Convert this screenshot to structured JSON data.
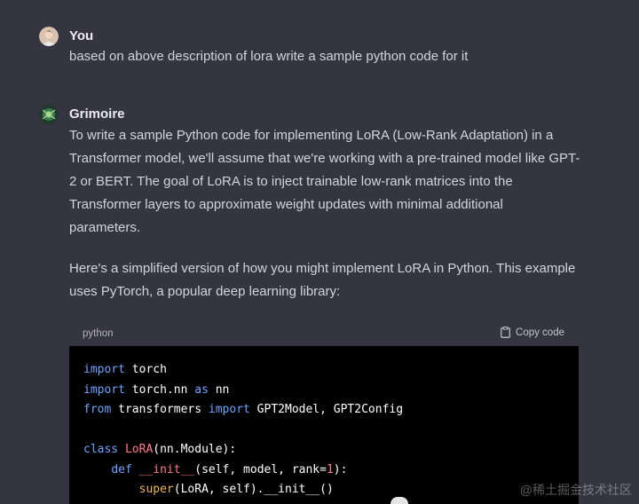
{
  "user_message": {
    "author": "You",
    "text": "based on above description of lora write a sample python code for it"
  },
  "assistant_message": {
    "author": "Grimoire",
    "paragraph1_lines": [
      "To write a sample Python code for implementing LoRA (Low-Rank Adaptation) in a",
      "Transformer model, we'll assume that we're working with a pre-trained model like GPT-",
      "2 or BERT. The goal of LoRA is to inject trainable low-rank matrices into the",
      "Transformer layers to approximate weight updates with minimal additional",
      "parameters."
    ],
    "paragraph2_lines": [
      "Here's a simplified version of how you might implement LoRA in Python. This example",
      "uses PyTorch, a popular deep learning library:"
    ]
  },
  "code_block": {
    "language": "python",
    "copy_label": "Copy code",
    "tokens": {
      "import": "import",
      "torch": " torch",
      "torch_nn": " torch.nn ",
      "as": "as",
      "nn": " nn",
      "from": "from",
      "transformers": " transformers ",
      "imports_list": " GPT2Model, GPT2Config",
      "class": "class",
      "lora_name": "LoRA",
      "class_base": "(nn.Module):",
      "indent1": "    ",
      "def": "def",
      "init_fn": "__init__",
      "init_args_pre": "(self, model, rank=",
      "rank_default": "1",
      "init_args_post": "):",
      "indent2": "        ",
      "super": "super",
      "super_call": "(LoRA, self).__init__()"
    }
  },
  "watermark": "@稀土掘金技术社区",
  "colors": {
    "background": "#343541",
    "code_background": "#000000",
    "keyword": "#6ea3ff",
    "class_name": "#ff7c8a",
    "builtin": "#f0b44a"
  }
}
